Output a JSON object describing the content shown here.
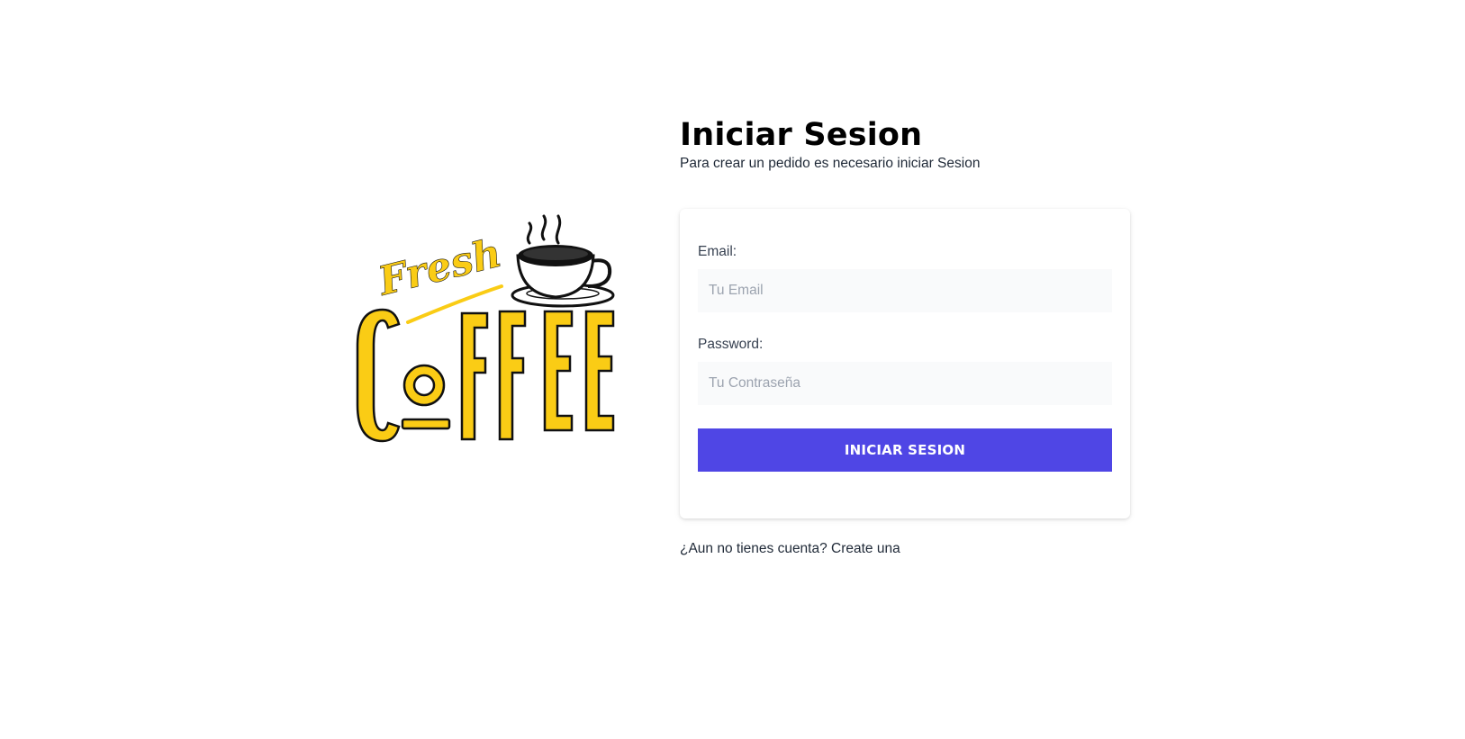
{
  "logo": {
    "text_top": "Fresh",
    "text_main": "COFFEE",
    "colors": {
      "primary": "#facc15",
      "outline": "#111111",
      "cup": "#111111"
    }
  },
  "header": {
    "title": "Iniciar Sesion",
    "subtitle": "Para crear un pedido es necesario iniciar Sesion"
  },
  "form": {
    "email": {
      "label": "Email:",
      "placeholder": "Tu Email",
      "value": ""
    },
    "password": {
      "label": "Password:",
      "placeholder": "Tu Contraseña",
      "value": ""
    },
    "submit_label": "Iniciar Sesion"
  },
  "footer": {
    "register_text": "¿Aun no tienes cuenta? Create una"
  },
  "colors": {
    "accent": "#4f46e5",
    "input_bg": "#f9fafb"
  }
}
